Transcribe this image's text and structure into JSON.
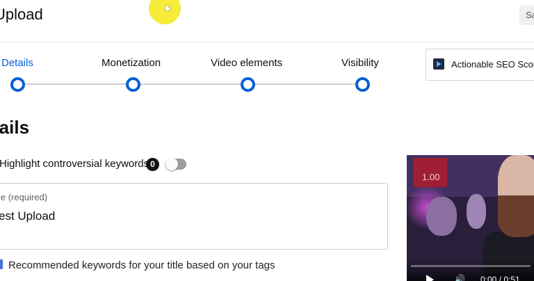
{
  "header": {
    "title": "Upload",
    "save_label": "Sa"
  },
  "stepper": {
    "steps": [
      {
        "label": "Details",
        "active": true
      },
      {
        "label": "Monetization",
        "active": false
      },
      {
        "label": "Video elements",
        "active": false
      },
      {
        "label": "Visibility",
        "active": false
      }
    ],
    "accent_color": "#065fd4"
  },
  "seo": {
    "label": "Actionable SEO Score:"
  },
  "details": {
    "section_title": "tails",
    "highlight_label": "Highlight controversial keywords",
    "highlight_count": "0",
    "highlight_toggle_on": false,
    "title_field_label": "le (required)",
    "title_field_value": "est Upload",
    "recommended_label": "Recommended keywords for your title based on your tags"
  },
  "video": {
    "speed_label": "1.00",
    "time_label": "0:00 / 0:51",
    "volume_icon": "volume-icon",
    "play_icon": "play-icon"
  }
}
